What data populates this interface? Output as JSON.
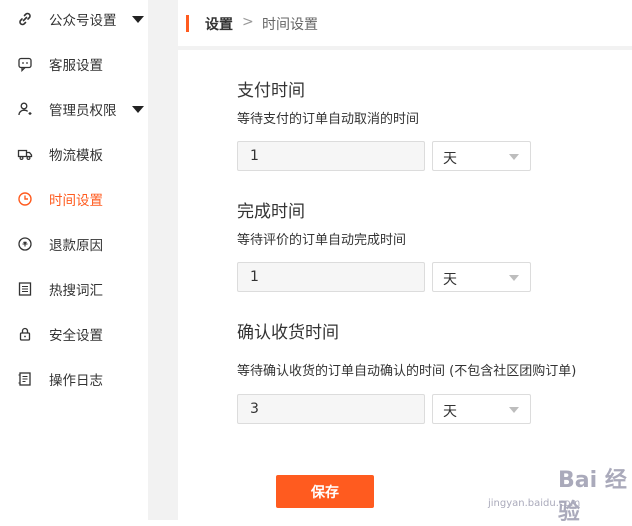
{
  "sidebar": {
    "items": [
      {
        "label": "公众号设置",
        "icon": "link-icon"
      },
      {
        "label": "客服设置",
        "icon": "chat-icon"
      },
      {
        "label": "管理员权限",
        "icon": "user-icon"
      },
      {
        "label": "物流模板",
        "icon": "truck-icon"
      },
      {
        "label": "时间设置",
        "icon": "clock-icon",
        "active": true
      },
      {
        "label": "退款原因",
        "icon": "refund-icon"
      },
      {
        "label": "热搜词汇",
        "icon": "list-icon"
      },
      {
        "label": "安全设置",
        "icon": "lock-icon"
      },
      {
        "label": "操作日志",
        "icon": "log-icon"
      }
    ]
  },
  "breadcrumb": {
    "root": "设置",
    "separator": ">",
    "current": "时间设置"
  },
  "sections": {
    "payment": {
      "title": "支付时间",
      "desc": "等待支付的订单自动取消的时间",
      "value": "1",
      "unit": "天"
    },
    "complete": {
      "title": "完成时间",
      "desc": "等待评价的订单自动完成时间",
      "value": "1",
      "unit": "天"
    },
    "confirm": {
      "title": "确认收货时间",
      "desc": "等待确认收货的订单自动确认的时间 (不包含社区团购订单)",
      "value": "3",
      "unit": "天"
    }
  },
  "save_label": "保存",
  "watermark": {
    "text": "Bai 经验",
    "sub": "jingyan.baidu.com"
  },
  "colors": {
    "accent": "#ff5b1f",
    "background": "#f2f2f2"
  }
}
